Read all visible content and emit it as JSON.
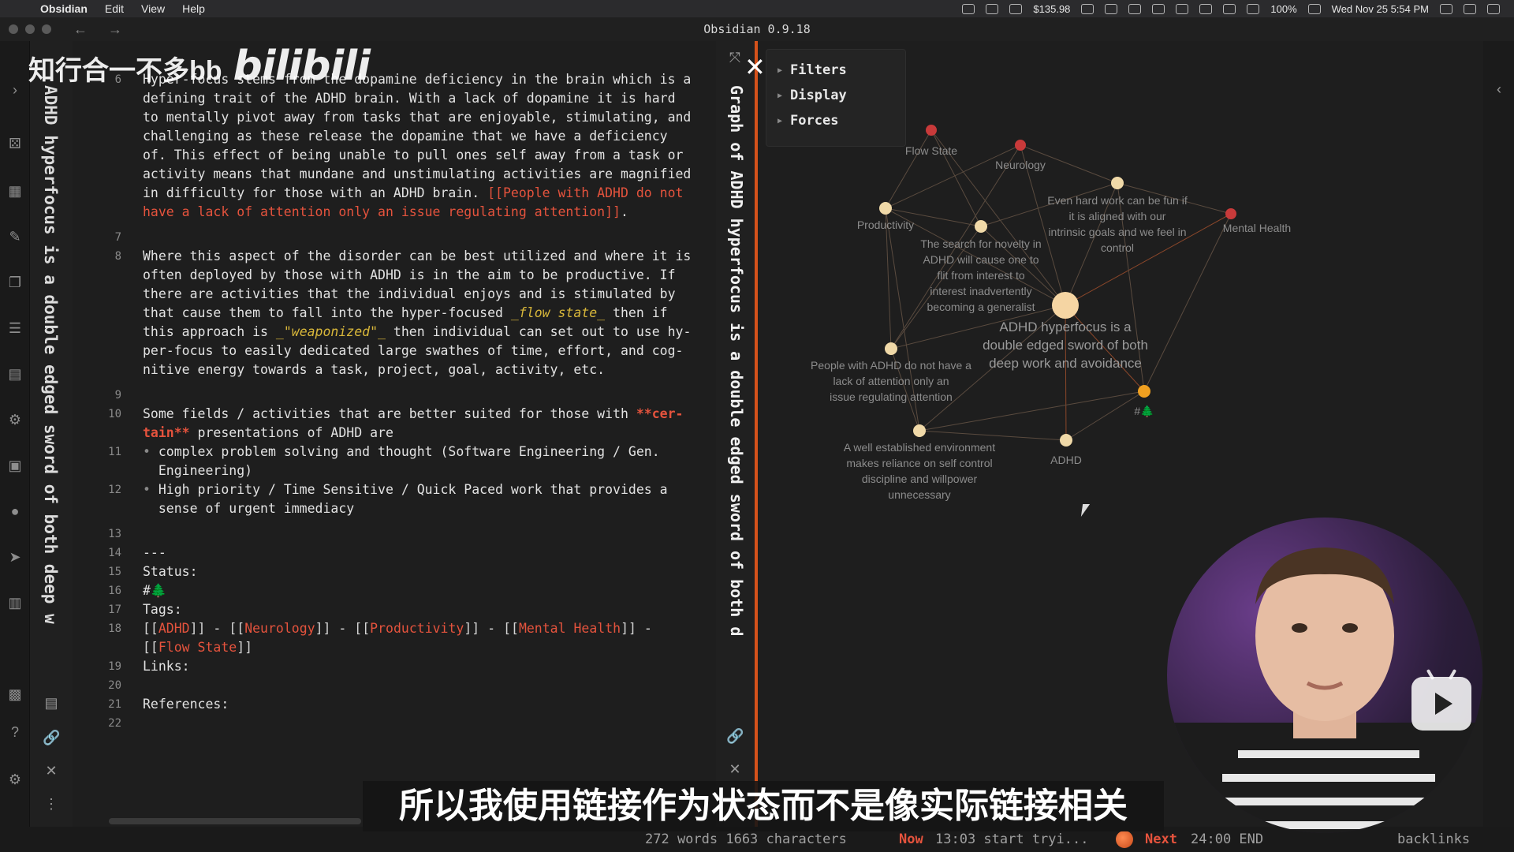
{
  "menubar": {
    "apple": "",
    "app_name": "Obsidian",
    "menus": [
      "Edit",
      "View",
      "Help"
    ],
    "stock": "$135.98",
    "battery": "100%",
    "datetime": "Wed Nov 25  5:54 PM"
  },
  "window": {
    "title": "Obsidian 0.9.18"
  },
  "watermark": {
    "text": "知行合一不多bb",
    "logo": "bilibili"
  },
  "left_strip": {
    "title": "ADHD hyperfocus is a double edged sword of both deep w"
  },
  "graph_strip": {
    "title": "Graph of ADHD hyperfocus is a double edged sword of both d"
  },
  "editor": {
    "lines": [
      {
        "n": "6",
        "html": "Hyper-focus stems from the dopamine deficiency in the brain which is a"
      },
      {
        "n": "",
        "html": "defining trait of the ADHD brain. With a lack of dopamine it is hard"
      },
      {
        "n": "",
        "html": "to mentally pivot away from tasks that are enjoyable, stimulating, and"
      },
      {
        "n": "",
        "html": "challenging as these release the dopamine that we have a deficiency"
      },
      {
        "n": "",
        "html": "of. This effect of being unable to pull ones self away from a task or"
      },
      {
        "n": "",
        "html": "activity means that mundane and unstimulating activities are magnified"
      },
      {
        "n": "",
        "html": "in difficulty for those with an ADHD brain. [[People with ADHD do not"
      },
      {
        "n": "",
        "html": "have a lack of attention only an issue regulating attention]]."
      },
      {
        "n": "7",
        "html": ""
      },
      {
        "n": "8",
        "html": "Where this aspect of the disorder can be best utilized and where it is"
      },
      {
        "n": "",
        "html": "often deployed by those with ADHD is in the aim to be productive. If"
      },
      {
        "n": "",
        "html": "there are activities that the individual enjoys and is stimulated by"
      },
      {
        "n": "",
        "html": "that cause them to fall into the hyper-focused _flow state_ then if"
      },
      {
        "n": "",
        "html": "this approach is _\"weaponized\"_ then individual can set out to use hy-"
      },
      {
        "n": "",
        "html": "per-focus to easily dedicated large swathes of time, effort, and cog-"
      },
      {
        "n": "",
        "html": "nitive energy towards a task, project, goal, activity, etc."
      },
      {
        "n": "9",
        "html": ""
      },
      {
        "n": "10",
        "html": "Some fields / activities that are better suited for those with **cer-"
      },
      {
        "n": "",
        "html": "tain** presentations of ADHD are"
      },
      {
        "n": "11",
        "html": "• complex problem solving and thought (Software Engineering / Gen."
      },
      {
        "n": "",
        "html": "  Engineering)"
      },
      {
        "n": "12",
        "html": "• High priority / Time Sensitive / Quick Paced work that provides a"
      },
      {
        "n": "",
        "html": "  sense of urgent immediacy"
      },
      {
        "n": "13",
        "html": ""
      },
      {
        "n": "14",
        "html": "---"
      },
      {
        "n": "15",
        "html": "Status:"
      },
      {
        "n": "16",
        "html": "#🌲"
      },
      {
        "n": "17",
        "html": "Tags:"
      },
      {
        "n": "18",
        "html": "[[ADHD]] - [[Neurology]] - [[Productivity]] - [[Mental Health]] -"
      },
      {
        "n": "",
        "html": "[[Flow State]]"
      },
      {
        "n": "19",
        "html": "Links:"
      },
      {
        "n": "20",
        "html": ""
      },
      {
        "n": "21",
        "html": "References:"
      },
      {
        "n": "22",
        "html": ""
      }
    ]
  },
  "graph": {
    "controls": [
      "Filters",
      "Display",
      "Forces"
    ],
    "nodes": [
      {
        "label": "Flow State",
        "color": "#c83a3a"
      },
      {
        "label": "Neurology",
        "color": "#c83a3a"
      },
      {
        "label": "Even hard work can be fun if it is aligned with our intrinsic goals and we feel in control",
        "color": "#f0d9a8"
      },
      {
        "label": "Mental Health",
        "color": "#c83a3a"
      },
      {
        "label": "Productivity",
        "color": "#f0d9a8"
      },
      {
        "label": "The search for novelty in ADHD will cause one to flit from interest to interest inadvertently becoming a generalist",
        "color": "#f0d9a8"
      },
      {
        "label": "ADHD hyperfocus is a double edged sword of both deep work and avoidance",
        "color": "#f5d5a3"
      },
      {
        "label": "People with ADHD do not have a lack of attention only an issue regulating attention",
        "color": "#f0d9a8"
      },
      {
        "label": "#🌲",
        "color": "#f0a020"
      },
      {
        "label": "A well established environment makes reliance on self control discipline and willpower unnecessary",
        "color": "#f0d9a8"
      },
      {
        "label": "ADHD",
        "color": "#f0d9a8"
      }
    ]
  },
  "statusbar": {
    "words": "272 words 1663 characters",
    "now_label": "Now",
    "now_value": "13:03 start tryi...",
    "next_label": "Next",
    "next_value": "24:00 END",
    "backlinks": "backlinks"
  },
  "subtitle": "所以我使用链接作为状态而不是像实际链接相关",
  "colors": {
    "accent": "#e5533d",
    "divider": "#d5521b",
    "background": "#1e1e1e"
  }
}
